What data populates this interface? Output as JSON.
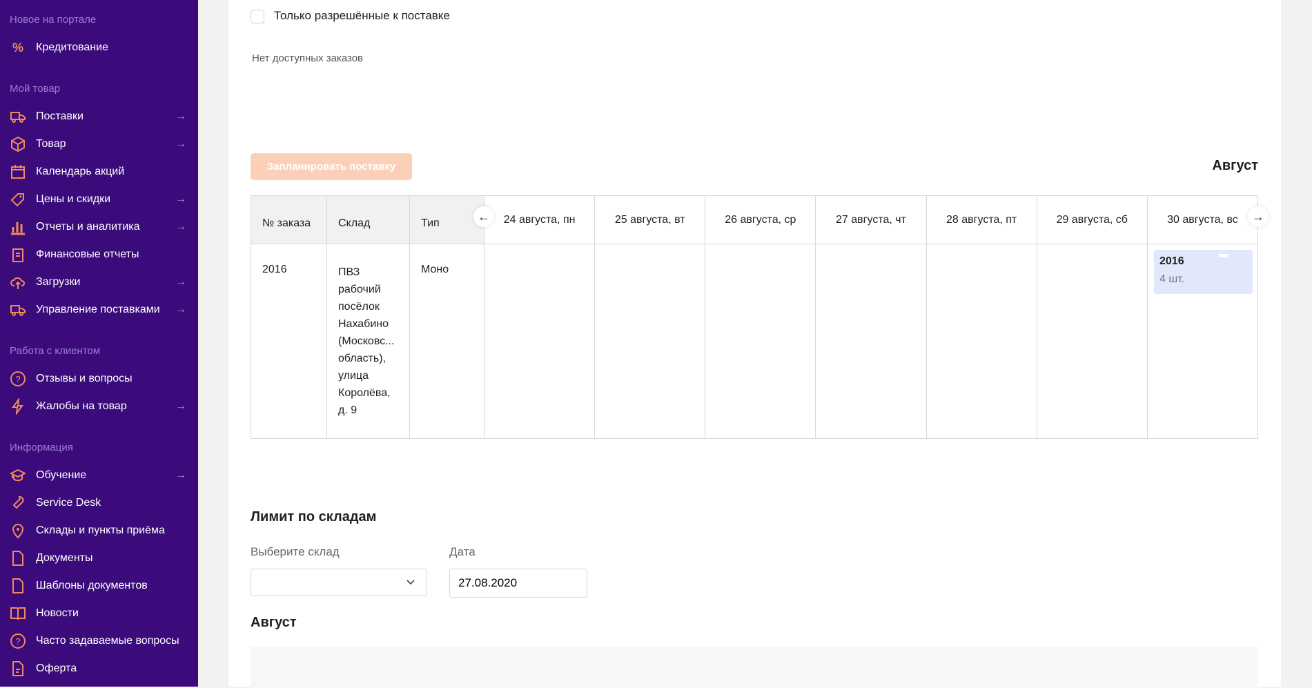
{
  "sidebar": {
    "accent": "#f08a5d",
    "sections": [
      {
        "label": "Новое на портале",
        "items": [
          {
            "label": "Кредитование",
            "icon": "percent-icon",
            "arrow": false
          }
        ]
      },
      {
        "label": "Мой товар",
        "items": [
          {
            "label": "Поставки",
            "icon": "truck-icon",
            "arrow": true
          },
          {
            "label": "Товар",
            "icon": "box-icon",
            "arrow": true
          },
          {
            "label": "Календарь акций",
            "icon": "calendar-icon",
            "arrow": false
          },
          {
            "label": "Цены и скидки",
            "icon": "tag-icon",
            "arrow": true
          },
          {
            "label": "Отчеты и аналитика",
            "icon": "bar-chart-icon",
            "arrow": true
          },
          {
            "label": "Финансовые отчеты",
            "icon": "clipboard-icon",
            "arrow": false
          },
          {
            "label": "Загрузки",
            "icon": "cloud-upload-icon",
            "arrow": true
          },
          {
            "label": "Управление поставками",
            "icon": "truck-icon",
            "arrow": true
          }
        ]
      },
      {
        "label": "Работа с клиентом",
        "items": [
          {
            "label": "Отзывы и вопросы",
            "icon": "question-circle-icon",
            "arrow": false
          },
          {
            "label": "Жалобы на товар",
            "icon": "lightning-icon",
            "arrow": true
          }
        ]
      },
      {
        "label": "Информация",
        "items": [
          {
            "label": "Обучение",
            "icon": "graduation-cap-icon",
            "arrow": true
          },
          {
            "label": "Service Desk",
            "icon": "wrench-icon",
            "arrow": false
          },
          {
            "label": "Склады и пункты приёма",
            "icon": "map-pin-icon",
            "arrow": false
          },
          {
            "label": "Документы",
            "icon": "file-icon",
            "arrow": false
          },
          {
            "label": "Шаблоны документов",
            "icon": "file-icon",
            "arrow": false
          },
          {
            "label": "Новости",
            "icon": "book-icon",
            "arrow": false
          },
          {
            "label": "Часто задаваемые вопросы",
            "icon": "question-circle-icon",
            "arrow": false
          },
          {
            "label": "Оферта",
            "icon": "document-icon",
            "arrow": false
          }
        ]
      }
    ]
  },
  "filters": {
    "allowed_only_label": "Только разрешённые к поставке",
    "allowed_only_checked": false
  },
  "orders": {
    "empty_text": "Нет доступных заказов"
  },
  "plan_button": "Запланировать поставку",
  "calendar": {
    "month": "Август",
    "columns": [
      "№ заказа",
      "Склад",
      "Тип"
    ],
    "days": [
      "24 августа, пн",
      "25 августа, вт",
      "26 августа, ср",
      "27 августа, чт",
      "28 августа, пт",
      "29 августа, сб",
      "30 августа, вс"
    ],
    "row": {
      "order": "2016",
      "warehouse": "ПВЗ рабочий посёлок Нахабино (Московс... область), улица Королёва, д. 9",
      "type": "Моно"
    },
    "booking": {
      "day": "30 августа, вс",
      "order": "2016",
      "qty": "4 шт."
    }
  },
  "limits": {
    "title": "Лимит по складам",
    "warehouse_label": "Выберите склад",
    "warehouse_value": "",
    "date_label": "Дата",
    "date_value": "27.08.2020",
    "month": "Август"
  }
}
